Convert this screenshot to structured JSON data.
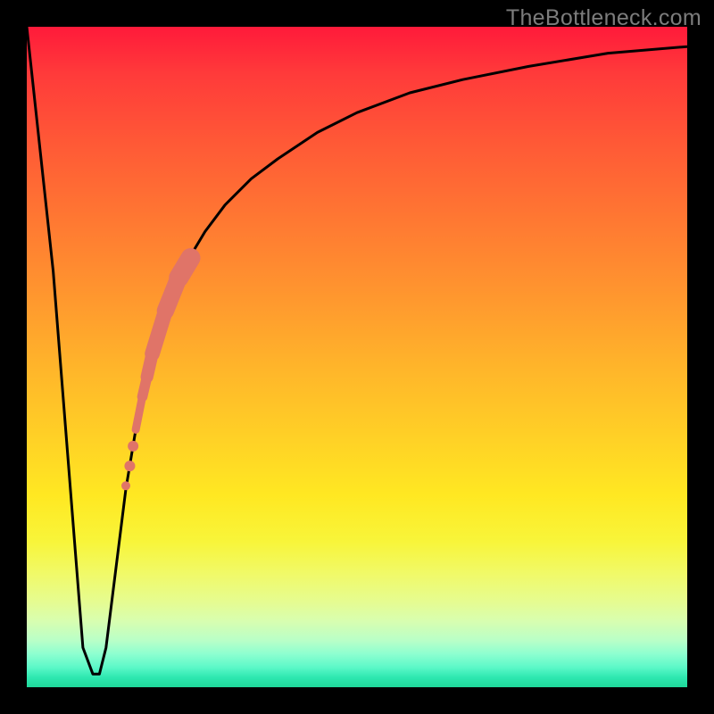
{
  "watermark": "TheBottleneck.com",
  "chart_data": {
    "type": "line",
    "title": "",
    "xlabel": "",
    "ylabel": "",
    "xlim": [
      0,
      100
    ],
    "ylim": [
      0,
      100
    ],
    "grid": false,
    "legend": false,
    "background_gradient": {
      "direction": "top-to-bottom",
      "stops": [
        {
          "pos": 0.0,
          "color": "#ff1a3a"
        },
        {
          "pos": 0.25,
          "color": "#ff7a32"
        },
        {
          "pos": 0.5,
          "color": "#ffb62a"
        },
        {
          "pos": 0.75,
          "color": "#f8f53a"
        },
        {
          "pos": 1.0,
          "color": "#1fd89a"
        }
      ]
    },
    "series": [
      {
        "name": "bottleneck-curve",
        "type": "line",
        "color": "#000000",
        "stroke_width": 3,
        "x": [
          0,
          4,
          7,
          8.5,
          10,
          11,
          12,
          13.5,
          15,
          17,
          19,
          21,
          24,
          27,
          30,
          34,
          38,
          44,
          50,
          58,
          66,
          76,
          88,
          100
        ],
        "y": [
          100,
          63,
          25,
          6,
          2,
          2,
          6,
          18,
          30,
          42,
          52,
          58,
          64,
          69,
          73,
          77,
          80,
          84,
          87,
          90,
          92,
          94,
          96,
          97
        ]
      },
      {
        "name": "highlight-segment",
        "type": "line",
        "color": "#e07468",
        "stroke_width_range": [
          9,
          22
        ],
        "cap": "round",
        "x": [
          16.5,
          17.5,
          18.2,
          19.0,
          21.0,
          23.0,
          24.8
        ],
        "y": [
          39.0,
          44.0,
          47.0,
          50.5,
          57.0,
          62.0,
          65.0
        ]
      },
      {
        "name": "highlight-dots",
        "type": "scatter",
        "color": "#e07468",
        "x": [
          15.0,
          15.6,
          16.1
        ],
        "y": [
          30.5,
          33.5,
          36.5
        ],
        "size": [
          10,
          12,
          12
        ]
      }
    ]
  }
}
